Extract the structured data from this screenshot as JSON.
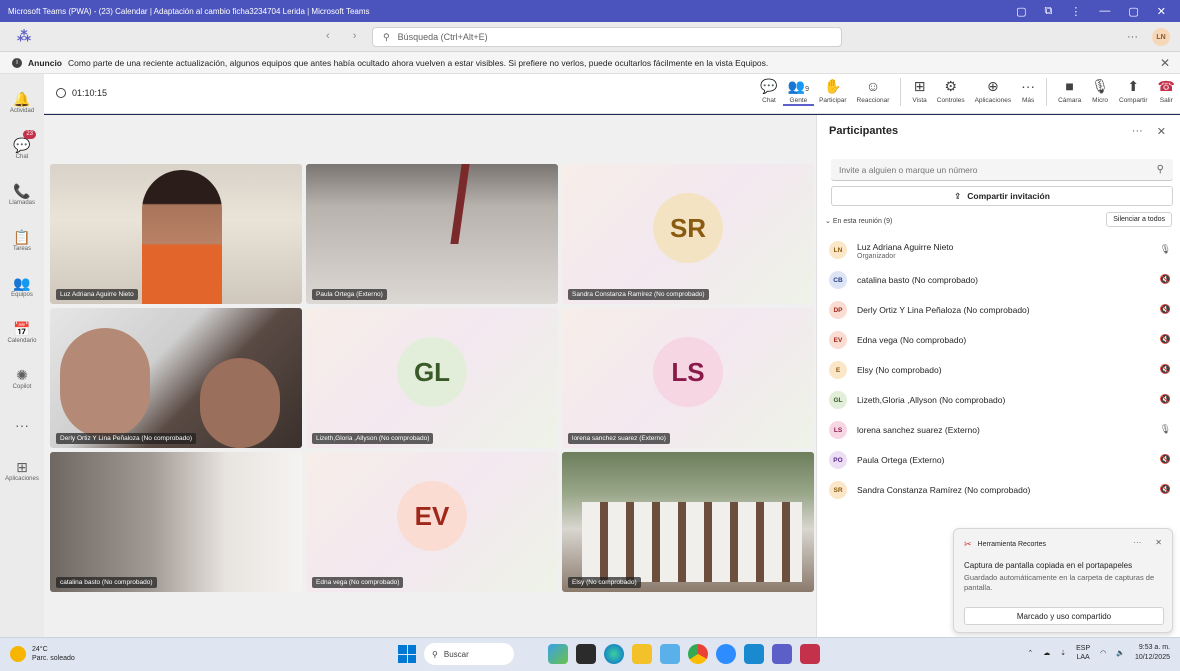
{
  "window": {
    "title": "Microsoft Teams (PWA) - (23) Calendar | Adaptación al cambio ficha3234704 Lerida | Microsoft Teams",
    "controls": [
      "▢",
      "⧉",
      "⋮",
      "—",
      "▢",
      "✕"
    ]
  },
  "appbar": {
    "search_placeholder": "Búsqueda (Ctrl+Alt+E)",
    "more": "···",
    "user_initials": "LN"
  },
  "banner": {
    "label": "Anuncio",
    "text": "Como parte de una reciente actualización, algunos equipos que antes había ocultado ahora vuelven a estar visibles. Si prefiere no verlos, puede ocultarlos fácilmente en la vista Equipos."
  },
  "rail": [
    {
      "label": "Actividad",
      "icon": "🔔"
    },
    {
      "label": "Chat",
      "icon": "💬",
      "badge": "23"
    },
    {
      "label": "Llamadas",
      "icon": "📞"
    },
    {
      "label": "Tareas",
      "icon": "📋"
    },
    {
      "label": "Equipos",
      "icon": "👥"
    },
    {
      "label": "Calendario",
      "icon": "📅"
    },
    {
      "label": "Copilot",
      "icon": "✺"
    },
    {
      "label": "",
      "icon": "···"
    },
    {
      "label": "Aplicaciones",
      "icon": "⊞"
    }
  ],
  "meeting": {
    "timer": "01:10:15",
    "tools": [
      {
        "label": "Chat",
        "icon": "💬"
      },
      {
        "label": "Gente",
        "icon": "👥",
        "count": "9"
      },
      {
        "label": "Participar",
        "icon": "✋"
      },
      {
        "label": "Reaccionar",
        "icon": "☺"
      }
    ],
    "tools2": [
      {
        "label": "Vista",
        "icon": "⊞"
      },
      {
        "label": "Controles",
        "icon": "⚙"
      },
      {
        "label": "Aplicaciones",
        "icon": "⊕"
      },
      {
        "label": "Más",
        "icon": "···"
      }
    ],
    "tools3": [
      {
        "label": "Cámara",
        "icon": "■"
      },
      {
        "label": "Micro",
        "icon": "🎙"
      },
      {
        "label": "Compartir",
        "icon": "⬆"
      },
      {
        "label": "Salir",
        "icon": "☎"
      }
    ]
  },
  "tiles": [
    {
      "name": "Luz Adriana Aguirre Nieto",
      "kind": "video-person",
      "initials": ""
    },
    {
      "name": "Paula Ortega (Externo)",
      "kind": "video-ceiling",
      "initials": ""
    },
    {
      "name": "Sandra Constanza Ramírez (No comprobado)",
      "kind": "avatar",
      "initials": "SR",
      "color": "#8a5a10",
      "bg": "#f3e3c3"
    },
    {
      "name": "Derly Ortiz Y Lina Peñaloza (No comprobado)",
      "kind": "video-faces",
      "initials": ""
    },
    {
      "name": "Lizeth,Gloria ,Allyson (No comprobado)",
      "kind": "avatar",
      "initials": "GL",
      "color": "#3a5a2a",
      "bg": "#e2eed9"
    },
    {
      "name": "lorena sanchez suarez (Externo)",
      "kind": "avatar",
      "initials": "LS",
      "color": "#8a1a4a",
      "bg": "#f7d6e4"
    },
    {
      "name": "catalina basto (No comprobado)",
      "kind": "video-blur",
      "initials": ""
    },
    {
      "name": "Edna vega (No comprobado)",
      "kind": "avatar",
      "initials": "EV",
      "color": "#a0281a",
      "bg": "#fadcd3"
    },
    {
      "name": "Elsy (No comprobado)",
      "kind": "video-class",
      "initials": ""
    }
  ],
  "panel": {
    "title": "Participantes",
    "invite_placeholder": "Invite a alguien o marque un número",
    "share_invite": "Compartir invitación",
    "section": "En esta reunión (9)",
    "mute_all": "Silenciar a todos",
    "participants": [
      {
        "initials": "LN",
        "name": "Luz Adriana Aguirre Nieto",
        "role": "Organizador",
        "mic": "🎙",
        "bg": "#fbe6c8",
        "fg": "#8a5a10"
      },
      {
        "initials": "CB",
        "name": "catalina basto (No comprobado)",
        "role": "",
        "mic": "🔇",
        "bg": "#dde4f5",
        "fg": "#2a3f8a"
      },
      {
        "initials": "DP",
        "name": "Derly Ortiz Y Lina Peñaloza (No comprobado)",
        "role": "",
        "mic": "🔇",
        "bg": "#fadcd3",
        "fg": "#a0281a"
      },
      {
        "initials": "EV",
        "name": "Edna vega (No comprobado)",
        "role": "",
        "mic": "🔇",
        "bg": "#fadcd3",
        "fg": "#a0281a"
      },
      {
        "initials": "E",
        "name": "Elsy (No comprobado)",
        "role": "",
        "mic": "🔇",
        "bg": "#fbe6c8",
        "fg": "#8a5a10"
      },
      {
        "initials": "GL",
        "name": "Lizeth,Gloria ,Allyson (No comprobado)",
        "role": "",
        "mic": "🔇",
        "bg": "#e2eed9",
        "fg": "#3a5a2a"
      },
      {
        "initials": "LS",
        "name": "lorena sanchez suarez (Externo)",
        "role": "",
        "mic": "🎙",
        "bg": "#f7d6e4",
        "fg": "#8a1a4a"
      },
      {
        "initials": "PO",
        "name": "Paula Ortega (Externo)",
        "role": "",
        "mic": "🔇",
        "bg": "#ecdff5",
        "fg": "#5a2a8a"
      },
      {
        "initials": "SR",
        "name": "Sandra Constanza Ramírez (No comprobado)",
        "role": "",
        "mic": "🔇",
        "bg": "#fbe6c8",
        "fg": "#8a5a10"
      }
    ]
  },
  "toast": {
    "app": "Herramienta Recortes",
    "title": "Captura de pantalla copiada en el portapapeles",
    "body": "Guardado automáticamente en la carpeta de capturas de pantalla.",
    "button": "Marcado y uso compartido"
  },
  "taskbar": {
    "temp": "24°C",
    "weather": "Parc. soleado",
    "search": "Buscar",
    "lang1": "ESP",
    "lang2": "LAA",
    "time": "9:53 a. m.",
    "date": "10/12/2025"
  }
}
